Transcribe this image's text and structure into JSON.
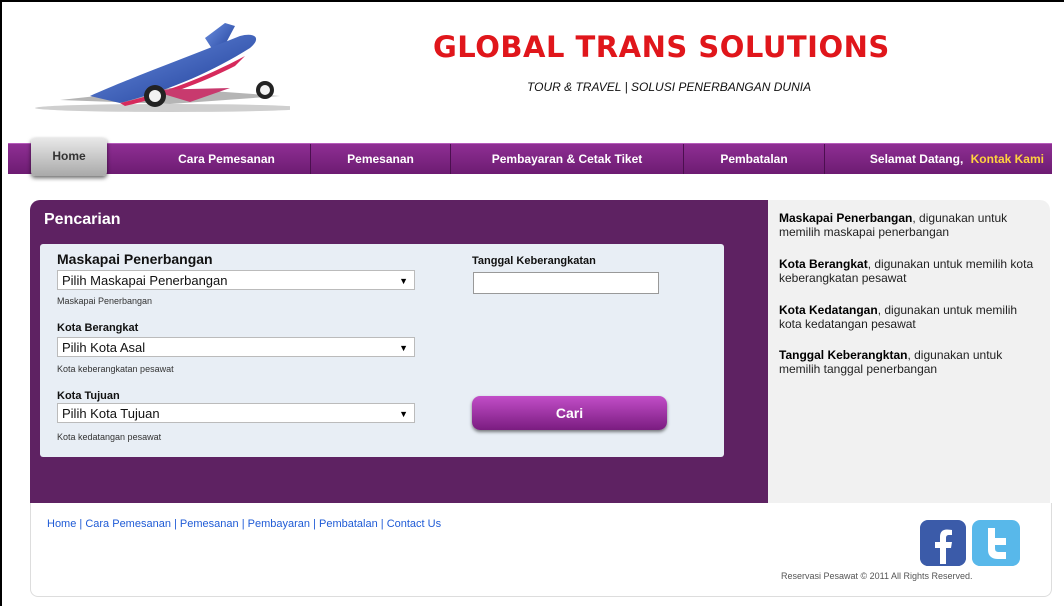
{
  "header": {
    "title": "GLOBAL TRANS SOLUTIONS",
    "subtitle": "TOUR & TRAVEL | SOLUSI PENERBANGAN DUNIA",
    "logo_icon": "airplane-icon"
  },
  "nav": {
    "items": [
      "Home",
      "Cara Pemesanan",
      "Pemesanan",
      "Pembayaran & Cetak Tiket",
      "Pembatalan"
    ],
    "welcome": "Selamat Datang,",
    "contact": "Kontak Kami"
  },
  "search": {
    "title": "Pencarian",
    "airline_label": "Maskapai Penerbangan",
    "airline_selected": "Pilih Maskapai Penerbangan",
    "airline_hint": "Maskapai Penerbangan",
    "origin_label": "Kota Berangkat",
    "origin_selected": "Pilih Kota Asal",
    "origin_hint": "Kota keberangkatan pesawat",
    "dest_label": "Kota Tujuan",
    "dest_selected": "Pilih Kota Tujuan",
    "dest_hint": "Kota kedatangan pesawat",
    "date_label": "Tanggal Keberangkatan",
    "date_value": "",
    "submit": "Cari"
  },
  "help": [
    {
      "term": "Maskapai Penerbangan",
      "desc": ", digunakan untuk memilih maskapai penerbangan"
    },
    {
      "term": "Kota Berangkat",
      "desc": ", digunakan untuk memilih kota keberangkatan pesawat"
    },
    {
      "term": "Kota Kedatangan",
      "desc": ", digunakan untuk memilih kota kedatangan pesawat"
    },
    {
      "term": "Tanggal Keberangktan",
      "desc": ", digunakan untuk memilih tanggal penerbangan"
    }
  ],
  "footer": {
    "links": [
      "Home",
      "Cara Pemesanan",
      "Pemesanan",
      "Pembayaran",
      "Pembatalan",
      "Contact Us"
    ],
    "separator": " | ",
    "copyright": "Reservasi Pesawat © 2011 All Rights Reserved.",
    "social": [
      "facebook-icon",
      "twitter-icon"
    ]
  },
  "colors": {
    "brand_red": "#e0161b",
    "nav_purple": "#7d2482",
    "panel_purple": "#5e2262",
    "accent_yellow": "#ffd23f",
    "link_blue": "#1f5bd6"
  }
}
